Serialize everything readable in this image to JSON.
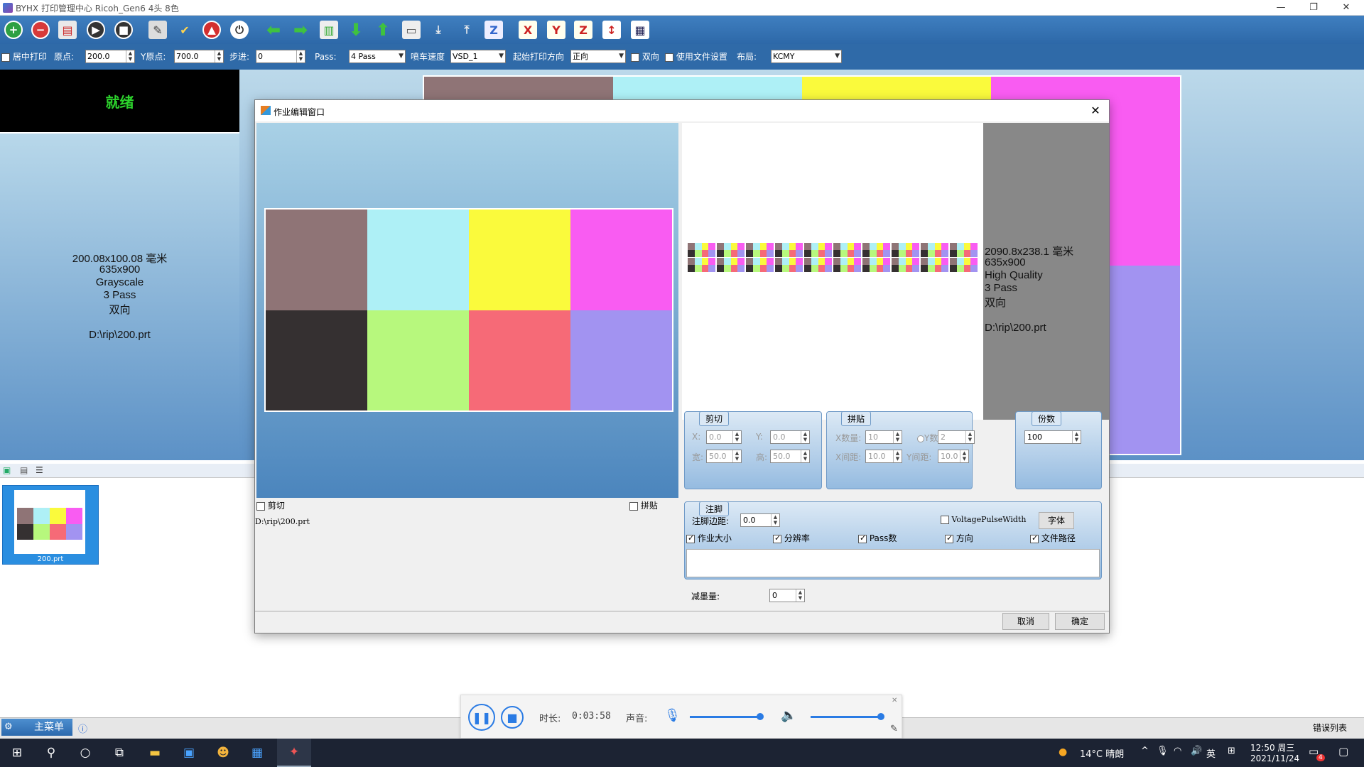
{
  "window": {
    "title": "BYHX  打印管理中心 Ricoh_Gen6 4头 8色"
  },
  "toolbar": {
    "icons": [
      "add-icon",
      "remove-icon",
      "print-icon",
      "play-icon",
      "stop-icon",
      "clean-icon",
      "check-icon",
      "abort-icon",
      "power-icon",
      "left-icon",
      "right-icon",
      "carriage-icon",
      "down-icon",
      "up-icon",
      "media-icon",
      "feed-icon",
      "lift-icon",
      "z-icon",
      "home-x-icon",
      "home-y-icon",
      "home-z-icon",
      "measure-icon",
      "settings-icon"
    ]
  },
  "params": {
    "center_print": "居中打印",
    "origin_label": "原点:",
    "origin_value": "200.0",
    "y_origin_label": "Y原点:",
    "y_origin_value": "700.0",
    "step_label": "步进:",
    "step_value": "0",
    "pass_label": "Pass:",
    "pass_value": "4 Pass",
    "speed_label": "喷车速度",
    "speed_value": "VSD_1",
    "direction_label": "起始打印方向",
    "direction_value": "正向",
    "bidir_label": "双向",
    "use_file_label": "使用文件设置",
    "layout_label": "布局:",
    "layout_value": "KCMY"
  },
  "status": {
    "text": "就绪"
  },
  "left_info": {
    "size": "200.08x100.08 毫米",
    "res": "635x900",
    "mode": "Grayscale",
    "pass": "3 Pass",
    "dir": "双向",
    "path": "D:\\rip\\200.prt"
  },
  "swatches": [
    "#8f7476",
    "#aef0f6",
    "#fafa3c",
    "#f95cf2",
    "#353031",
    "#b7f87d",
    "#f66a77",
    "#a293f1"
  ],
  "thumb": {
    "name": "200.prt"
  },
  "dialog": {
    "title": "作业编辑窗口",
    "cut_check": "剪切",
    "tile_check": "拼贴",
    "path": "D:\\rip\\200.prt",
    "info": {
      "size": "2090.8x238.1 毫米",
      "res": "635x900",
      "quality": "High Quality",
      "pass": "3 Pass",
      "dir": "双向",
      "path": "D:\\rip\\200.prt"
    },
    "cut": {
      "title": "剪切",
      "x_label": "X:",
      "x": "0.0",
      "y_label": "Y:",
      "y": "0.0",
      "w_label": "宽:",
      "w": "50.0",
      "h_label": "高:",
      "h": "50.0"
    },
    "tile": {
      "title": "拼贴",
      "xcount_label": "X数量:",
      "xcount": "10",
      "ycount_label": "Y数量:",
      "ycount": "2",
      "xgap_label": "X间距:",
      "xgap": "10.0",
      "ygap_label": "Y间距:",
      "ygap": "10.0"
    },
    "copies": {
      "title": "份数",
      "value": "100"
    },
    "footnote": {
      "title": "注脚",
      "margin_label": "注脚边距:",
      "margin": "0.0",
      "voltage": "VoltagePulseWidth",
      "font_btn": "字体",
      "job_size": "作业大小",
      "resolution": "分辨率",
      "pass_count": "Pass数",
      "direction": "方向",
      "file_path": "文件路径"
    },
    "ink_reduce_label": "减墨量:",
    "ink_reduce": "0",
    "cancel": "取消",
    "ok": "确定"
  },
  "media": {
    "duration_label": "时长:",
    "duration": "0:03:58",
    "volume_label": "声音:"
  },
  "bottombar": {
    "main_menu": "主菜单",
    "error_list": "错误列表"
  },
  "taskbar": {
    "weather": "14°C 晴朗",
    "ime": "英",
    "time": "12:50 周三",
    "date": "2021/11/24",
    "notif": "4"
  }
}
